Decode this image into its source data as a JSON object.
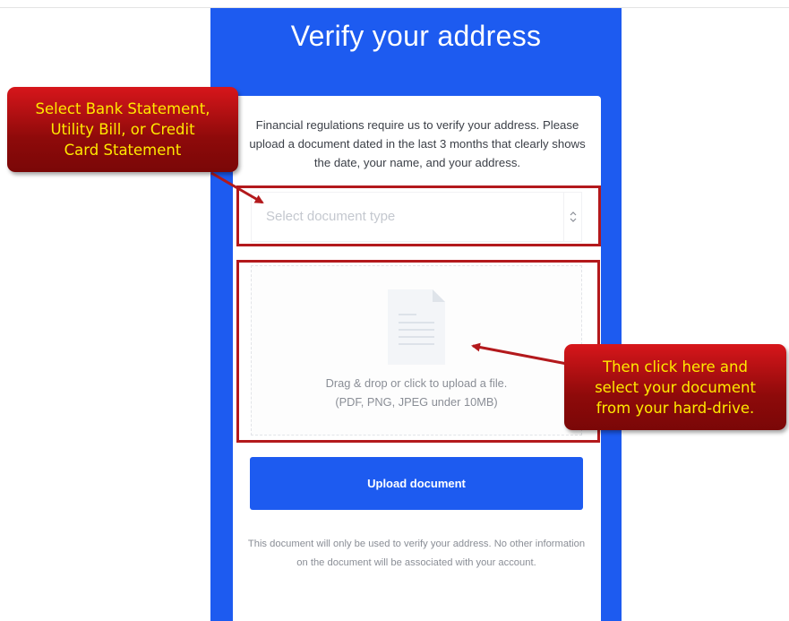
{
  "page": {
    "heading": "Verify your address",
    "intro_text": "Financial regulations require us to verify your address. Please upload a document dated in the last 3 months that clearly shows the date, your name, and your address."
  },
  "document_type_select": {
    "placeholder": "Select document type",
    "chevron_icon": "up-down-chevron-icon"
  },
  "dropzone": {
    "icon": "document-icon",
    "instruction": "Drag & drop or click to upload a file.",
    "formats": "(PDF, PNG, JPEG under 10MB)"
  },
  "upload_button": {
    "label": "Upload document"
  },
  "footnote": "This document will only be used to verify your address. No other information on the document will be associated with your account.",
  "annotations": {
    "select_callout": "Select Bank Statement,\nUtility Bill, or Credit\nCard Statement",
    "dropzone_callout": "Then click here and\nselect your document\nfrom your hard-drive."
  },
  "colors": {
    "brand_blue": "#1d5bf0",
    "annotation_red": "#b3191c",
    "annotation_text_yellow": "#ffe900"
  }
}
